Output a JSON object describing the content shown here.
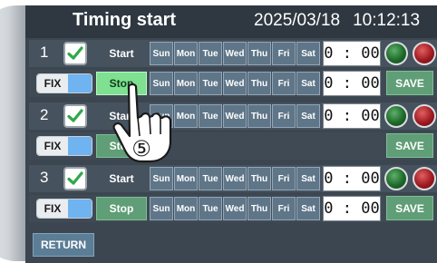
{
  "header": {
    "title": "Timing start",
    "date": "2025/03/18",
    "time": "10:12:13"
  },
  "days": [
    "Sun",
    "Mon",
    "Tue",
    "Wed",
    "Thu",
    "Fri",
    "Sat"
  ],
  "rows": [
    {
      "number": "1",
      "checked": true,
      "start_label": "Start",
      "start_time": "0 : 00",
      "fix_label": "FIX",
      "stop_label": "Stop",
      "stop_time": "0 : 00",
      "save_label": "SAVE",
      "stop_active": true
    },
    {
      "number": "2",
      "checked": true,
      "start_label": "Start",
      "start_time": "0 : 00",
      "fix_label": "FIX",
      "stop_label": "Stop",
      "save_label": "SAVE",
      "stop_active": false
    },
    {
      "number": "3",
      "checked": true,
      "start_label": "Start",
      "start_time": "0 : 00",
      "fix_label": "FIX",
      "stop_label": "Stop",
      "stop_time": "0 : 00",
      "save_label": "SAVE",
      "stop_active": false
    }
  ],
  "return_label": "RETURN",
  "callout": {
    "step_marker": "⑤"
  },
  "colors": {
    "screen_bg": "#3c4650",
    "day_button": "#5f7689",
    "save_button": "#5f9e76",
    "stop_active": "#7ee090",
    "checkbox_green": "#2fa84a",
    "led_green": "#1e6b2b",
    "led_red": "#a01a22",
    "fix_slot_blue": "#6fb3f0"
  },
  "icons": {
    "checkbox": "check-icon",
    "status_on": "green-indicator-icon",
    "status_off": "red-indicator-icon",
    "pointer": "pointing-hand-icon"
  }
}
